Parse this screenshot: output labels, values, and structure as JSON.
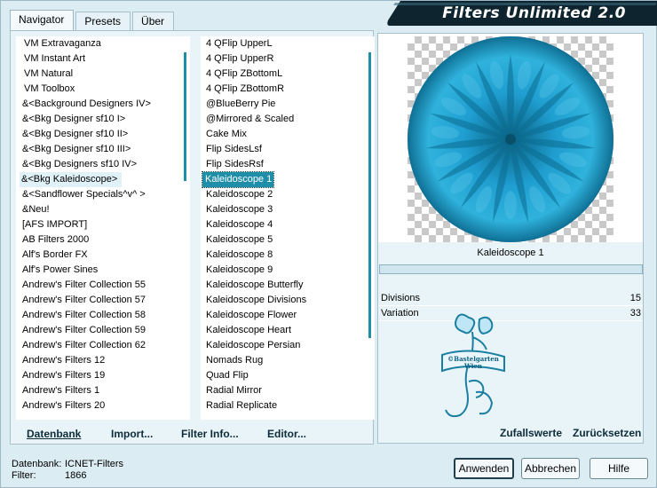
{
  "title": "Filters Unlimited 2.0",
  "tabs": [
    "Navigator",
    "Presets",
    "Über"
  ],
  "categories": [
    "VM Extravaganza",
    "VM Instant Art",
    "VM Natural",
    "VM Toolbox",
    "&<Background Designers IV>",
    "&<Bkg Designer sf10 I>",
    "&<Bkg Designer sf10 II>",
    "&<Bkg Designer sf10 III>",
    "&<Bkg Designers sf10 IV>",
    "&<Bkg Kaleidoscope>",
    "&<Sandflower Specials^v^ >",
    "&Neu!",
    "[AFS IMPORT]",
    "AB Filters 2000",
    "Alf's Border FX",
    "Alf's Power Sines",
    "Andrew's Filter Collection 55",
    "Andrew's Filter Collection 57",
    "Andrew's Filter Collection 58",
    "Andrew's Filter Collection 59",
    "Andrew's Filter Collection 62",
    "Andrew's Filters 12",
    "Andrew's Filters 19",
    "Andrew's Filters 1",
    "Andrew's Filters 20"
  ],
  "filters": [
    "4 QFlip UpperL",
    "4 QFlip UpperR",
    "4 QFlip ZBottomL",
    "4 QFlip ZBottomR",
    "@BlueBerry Pie",
    "@Mirrored & Scaled",
    "Cake Mix",
    "Flip SidesLsf",
    "Flip SidesRsf",
    "Kaleidoscope 1",
    "Kaleidoscope 2",
    "Kaleidoscope 3",
    "Kaleidoscope 4",
    "Kaleidoscope 5",
    "Kaleidoscope 8",
    "Kaleidoscope 9",
    "Kaleidoscope Butterfly",
    "Kaleidoscope Divisions",
    "Kaleidoscope Flower",
    "Kaleidoscope Heart",
    "Kaleidoscope Persian",
    "Nomads Rug",
    "Quad Flip",
    "Radial Mirror",
    "Radial Replicate"
  ],
  "bottom_buttons": {
    "database": "Datenbank",
    "import": "Import...",
    "filter_info": "Filter Info...",
    "editor": "Editor..."
  },
  "preview": {
    "filter_name": "Kaleidoscope 1",
    "params": [
      {
        "label": "Divisions",
        "value": "15"
      },
      {
        "label": "Variation",
        "value": "33"
      }
    ],
    "logo_text": "©Bastelgarten Wien",
    "random": "Zufallswerte",
    "reset": "Zurücksetzen"
  },
  "footer": {
    "db_label": "Datenbank:",
    "db_value": "ICNET-Filters",
    "filter_label": "Filter:",
    "filter_value": "1866",
    "apply": "Anwenden",
    "cancel": "Abbrechen",
    "help": "Hilfe"
  },
  "colors": {
    "accent": "#1f8fa9",
    "banner": "#0e2530"
  }
}
